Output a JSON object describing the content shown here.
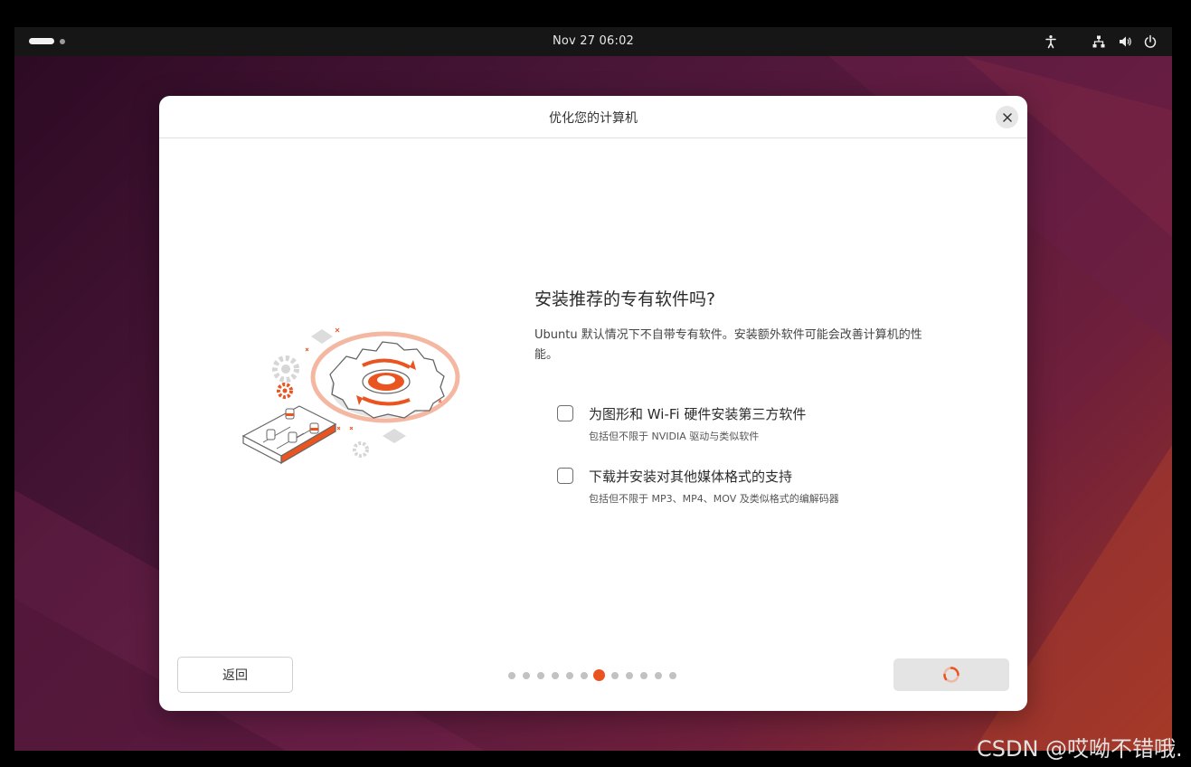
{
  "topbar": {
    "clock": "Nov 27  06:02",
    "icons": [
      "accessibility-icon",
      "network-icon",
      "volume-icon",
      "power-icon"
    ]
  },
  "dialog": {
    "title": "优化您的计算机",
    "close_icon": "close-icon",
    "heading": "安装推荐的专有软件吗?",
    "description": "Ubuntu 默认情况下不自带专有软件。安装额外软件可能会改善计算机的性能。",
    "options": [
      {
        "label": "为图形和 Wi-Fi 硬件安装第三方软件",
        "sublabel": "包括但不限于 NVIDIA 驱动与类似软件",
        "checked": false
      },
      {
        "label": "下载并安装对其他媒体格式的支持",
        "sublabel": "包括但不限于 MP3、MP4、MOV 及类似格式的编解码器",
        "checked": false
      }
    ],
    "back_button": "返回",
    "progress": {
      "total_steps": 12,
      "current_step": 7
    },
    "next_button_state": "loading-spinner"
  },
  "colors": {
    "accent": "#e95420",
    "dialog_bg": "#ffffff",
    "topbar_bg": "#161616"
  },
  "watermark": "CSDN @哎呦不错哦."
}
